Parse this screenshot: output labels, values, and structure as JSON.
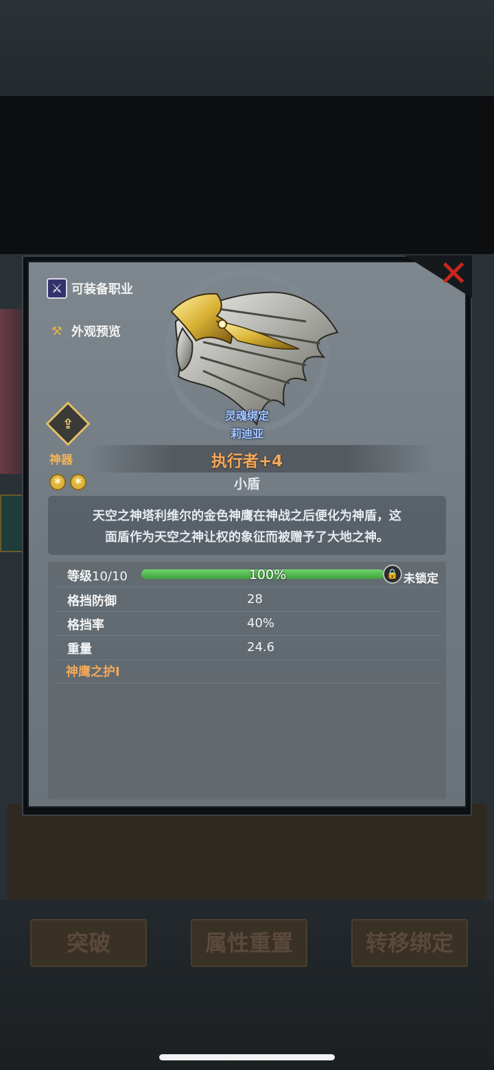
{
  "item": {
    "category": "神器",
    "name": "执行者+4",
    "type": "小盾",
    "bind_status": "灵魂绑定",
    "bound_to": "莉迪亚",
    "description_line1": "天空之神塔利维尔的金色神鹰在神战之后便化为神盾，这",
    "description_line2": "面盾作为天空之神让权的象征而被赠予了大地之神。",
    "stars": 2,
    "rarity_icon": "artifact-rarity-icon"
  },
  "side_links": {
    "jobs": "可装备职业",
    "appearance": "外观预览"
  },
  "level": {
    "label": "等级",
    "value": "10/10",
    "percent_text": "100%",
    "progress": 1.0,
    "lock_text": "未锁定"
  },
  "stats": [
    {
      "label": "格挡防御",
      "value": "28"
    },
    {
      "label": "格挡率",
      "value": "40%"
    },
    {
      "label": "重量",
      "value": "24.6"
    }
  ],
  "skill": "神鹰之护I",
  "bottom_buttons": {
    "breakthrough": "突破",
    "reset": "属性重置",
    "transfer": "转移绑定"
  },
  "colors": {
    "accent_orange": "#f4a85a",
    "bind_blue": "#a6c8ff",
    "progress_green": "#4fbf4c",
    "close_red": "#c7261e"
  }
}
